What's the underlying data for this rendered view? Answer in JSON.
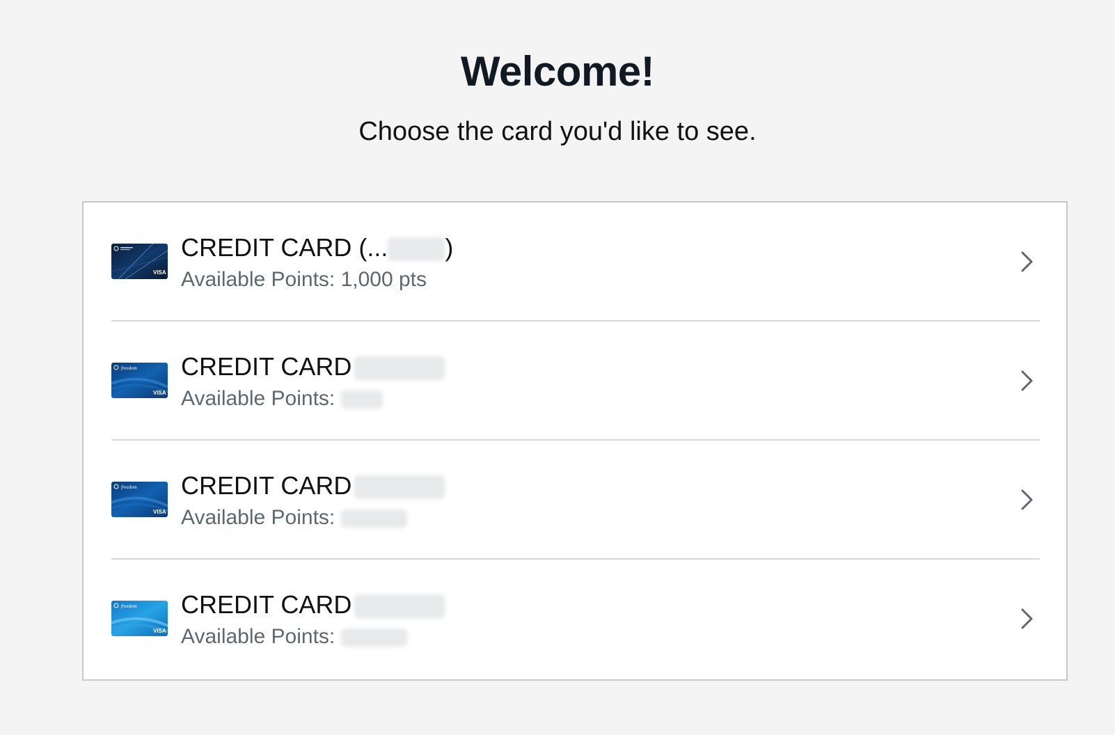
{
  "page": {
    "title": "Welcome!",
    "subtitle": "Choose the card you'd like to see."
  },
  "cards": [
    {
      "name": "CREDIT CARD (...",
      "name_suffix": ")",
      "points_label": "Available Points:",
      "points_value": "1,000 pts",
      "card_art": "sapphire-card-art",
      "chevron_icon": "chevron-right-icon"
    },
    {
      "name": "CREDIT CARD",
      "name_suffix": "",
      "points_label": "Available Points:",
      "points_value": "",
      "card_art": "freedom-card-art",
      "chevron_icon": "chevron-right-icon"
    },
    {
      "name": "CREDIT CARD",
      "name_suffix": "",
      "points_label": "Available Points:",
      "points_value": "",
      "card_art": "freedom-card-art",
      "chevron_icon": "chevron-right-icon"
    },
    {
      "name": "CREDIT CARD",
      "name_suffix": "",
      "points_label": "Available Points:",
      "points_value": "",
      "card_art": "freedom-light-card-art",
      "chevron_icon": "chevron-right-icon"
    }
  ],
  "colors": {
    "background": "#f4f4f4",
    "panel": "#ffffff",
    "title": "#111a22",
    "muted_text": "#5d6770",
    "divider": "#d5d8da",
    "chevron": "#5d6770"
  }
}
